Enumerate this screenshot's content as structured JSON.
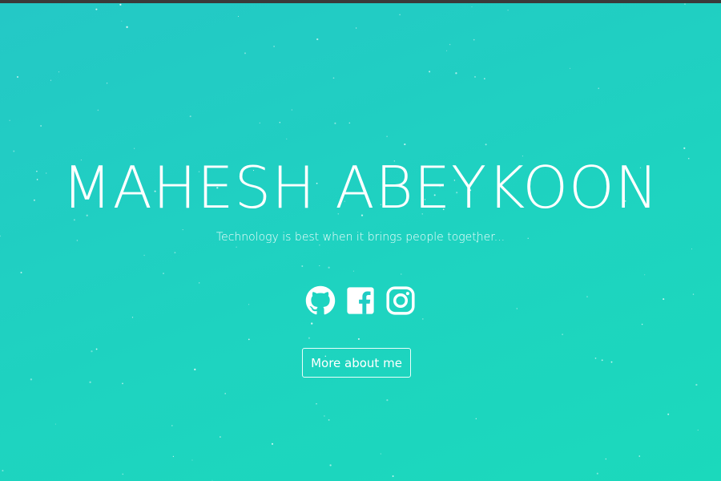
{
  "hero": {
    "name": "MAHESH ABEYKOON",
    "tagline": "Technology is best when it brings people together..."
  },
  "social": [
    {
      "icon": "github-icon"
    },
    {
      "icon": "facebook-icon"
    },
    {
      "icon": "instagram-icon"
    }
  ],
  "cta": {
    "label": "More about me"
  },
  "colors": {
    "gradient_start": "#24c8c6",
    "gradient_end": "#1bd9bc",
    "text": "#ffffff"
  }
}
